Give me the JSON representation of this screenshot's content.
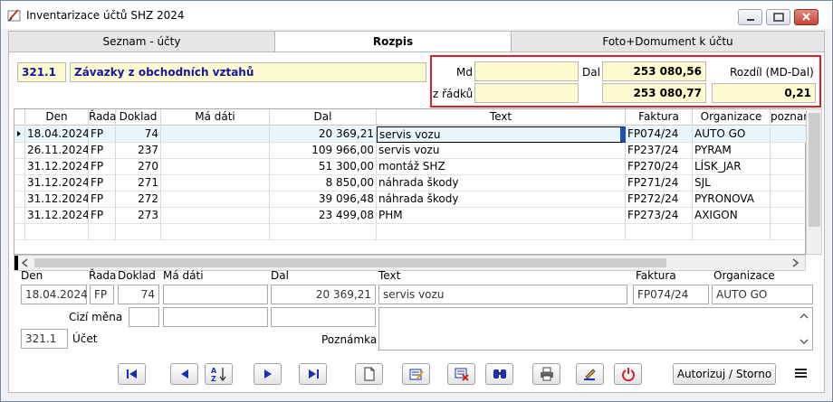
{
  "window": {
    "title": "Inventarizace účtů SHZ 2024"
  },
  "tabs": [
    {
      "label": "Seznam - účty"
    },
    {
      "label": "Rozpis"
    },
    {
      "label": "Foto+Domument k účtu"
    }
  ],
  "account": {
    "code": "321.1",
    "name": "Závazky z obchodních vztahů"
  },
  "summary": {
    "md_label": "Md",
    "dal_label": "Dal",
    "diff_label": "Rozdíl (MD-Dal)",
    "rows_label": "z řádků",
    "md_value": "",
    "dal_value": "253 080,56",
    "rows_md": "",
    "rows_dal": "253 080,77",
    "diff_value": "0,21"
  },
  "grid": {
    "headers": [
      "Den",
      "Řada",
      "Doklad",
      "Má dáti",
      "Dal",
      "Text",
      "Faktura",
      "Organizace",
      "poznar"
    ],
    "rows": [
      [
        "18.04.2024",
        "FP",
        "74",
        "",
        "20 369,21",
        "servis vozu",
        "FP074/24",
        "AUTO GO",
        ""
      ],
      [
        "26.11.2024",
        "FP",
        "237",
        "",
        "109 966,00",
        "servis vozu",
        "FP237/24",
        "PYRAM",
        ""
      ],
      [
        "31.12.2024",
        "FP",
        "270",
        "",
        "51 300,00",
        "montáž SHZ",
        "FP270/24",
        "LÍSK_JAR",
        ""
      ],
      [
        "31.12.2024",
        "FP",
        "271",
        "",
        "8 850,00",
        "náhrada škody",
        "FP271/24",
        "SJL",
        ""
      ],
      [
        "31.12.2024",
        "FP",
        "272",
        "",
        "39 096,48",
        "náhrada škody",
        "FP272/24",
        "PYRONOVA",
        ""
      ],
      [
        "31.12.2024",
        "FP",
        "273",
        "",
        "23 499,08",
        "PHM",
        "FP273/24",
        "AXIGON",
        ""
      ]
    ]
  },
  "detail": {
    "labels": {
      "den": "Den",
      "rada": "Řada",
      "doklad": "Doklad",
      "ma_dati": "Má dáti",
      "dal": "Dal",
      "text": "Text",
      "faktura": "Faktura",
      "organizace": "Organizace",
      "cizi_mena": "Cizí měna",
      "ucet": "Účet",
      "poznamka": "Poznámka"
    },
    "den": "18.04.2024",
    "rada": "FP",
    "doklad": "74",
    "ma_dati": "",
    "dal": "20 369,21",
    "text": "servis vozu",
    "faktura": "FP074/24",
    "organizace": "AUTO GO",
    "ucet": "321.1"
  },
  "toolbar": {
    "authorize_label": "Autorizuj / Storno"
  },
  "colors": {
    "highlight": "#d81f2a",
    "accent_blue": "#1515a0",
    "yellow_field": "#fffbd0"
  }
}
